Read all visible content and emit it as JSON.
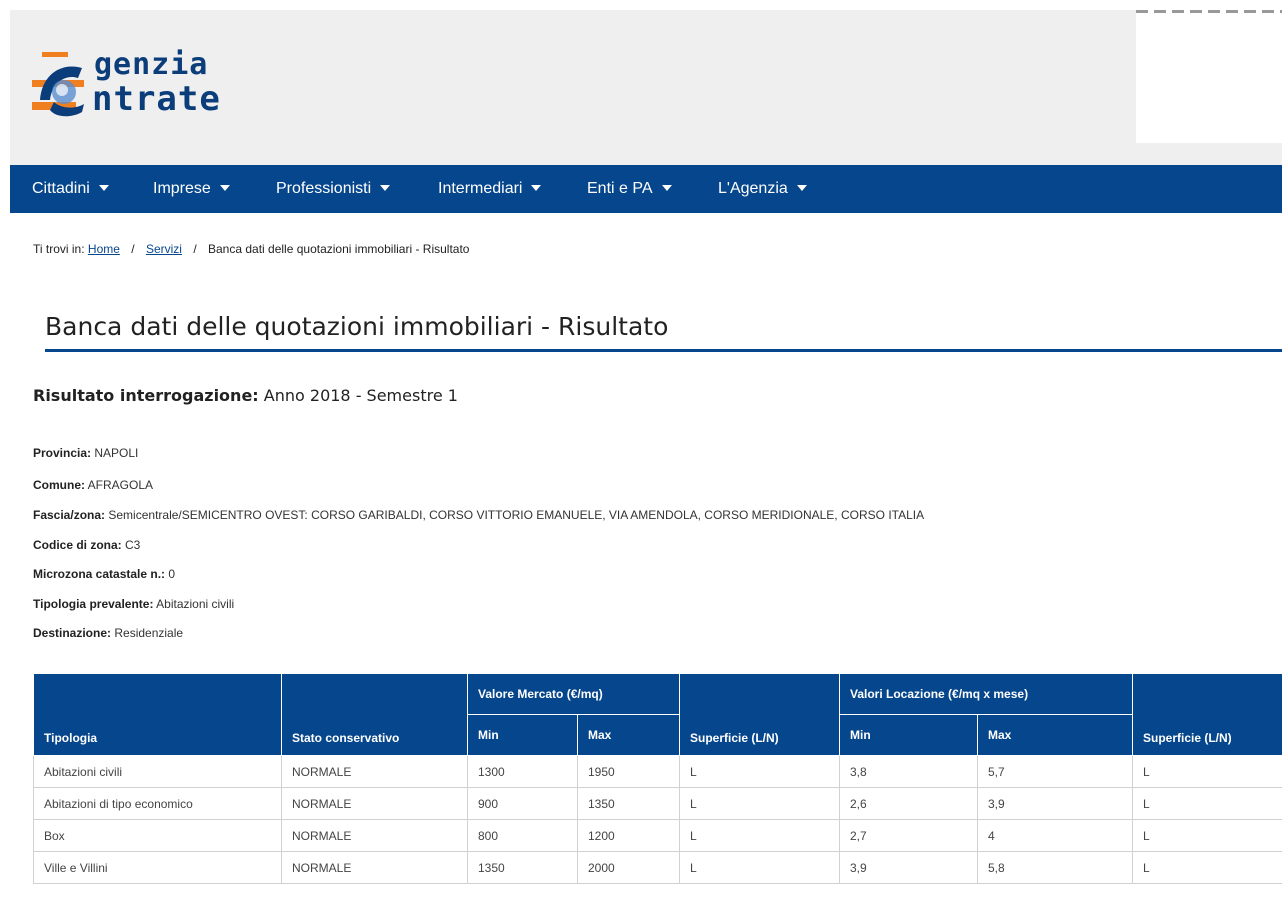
{
  "logo": {
    "line1": "genzia",
    "line2": "ntrate",
    "colors": {
      "blue": "#0b3d7a",
      "orange": "#f07f1f"
    }
  },
  "nav": [
    {
      "label": "Cittadini"
    },
    {
      "label": "Imprese"
    },
    {
      "label": "Professionisti"
    },
    {
      "label": "Intermediari"
    },
    {
      "label": "Enti e PA"
    },
    {
      "label": "L'Agenzia"
    }
  ],
  "breadcrumb": {
    "prefix": "Ti trovi in:",
    "home": "Home",
    "sep": "/",
    "servizi": "Servizi",
    "current": "Banca dati delle quotazioni immobiliari - Risultato"
  },
  "page_title": "Banca dati delle quotazioni immobiliari - Risultato",
  "result": {
    "label": "Risultato interrogazione:",
    "value": "Anno 2018 - Semestre 1"
  },
  "info": [
    {
      "label": "Provincia:",
      "value": "NAPOLI"
    },
    {
      "label": "Comune:",
      "value": "AFRAGOLA"
    },
    {
      "label": "Fascia/zona:",
      "value": "Semicentrale/SEMICENTRO OVEST: CORSO GARIBALDI, CORSO VITTORIO EMANUELE, VIA AMENDOLA, CORSO MERIDIONALE, CORSO ITALIA"
    },
    {
      "label": "Codice di zona:",
      "value": "C3"
    },
    {
      "label": "Microzona catastale n.:",
      "value": "0"
    },
    {
      "label": "Tipologia prevalente:",
      "value": "Abitazioni civili"
    },
    {
      "label": "Destinazione:",
      "value": "Residenziale"
    }
  ],
  "table": {
    "h_tipologia": "Tipologia",
    "h_stato": "Stato conservativo",
    "h_mercato": "Valore Mercato (€/mq)",
    "h_locazione": "Valori Locazione (€/mq x mese)",
    "h_min": "Min",
    "h_max": "Max",
    "h_superficie": "Superficie (L/N)",
    "rows": [
      [
        "Abitazioni civili",
        "NORMALE",
        "1300",
        "1950",
        "L",
        "3,8",
        "5,7",
        "L"
      ],
      [
        "Abitazioni di tipo economico",
        "NORMALE",
        "900",
        "1350",
        "L",
        "2,6",
        "3,9",
        "L"
      ],
      [
        "Box",
        "NORMALE",
        "800",
        "1200",
        "L",
        "2,7",
        "4",
        "L"
      ],
      [
        "Ville e Villini",
        "NORMALE",
        "1350",
        "2000",
        "L",
        "3,9",
        "5,8",
        "L"
      ]
    ]
  }
}
